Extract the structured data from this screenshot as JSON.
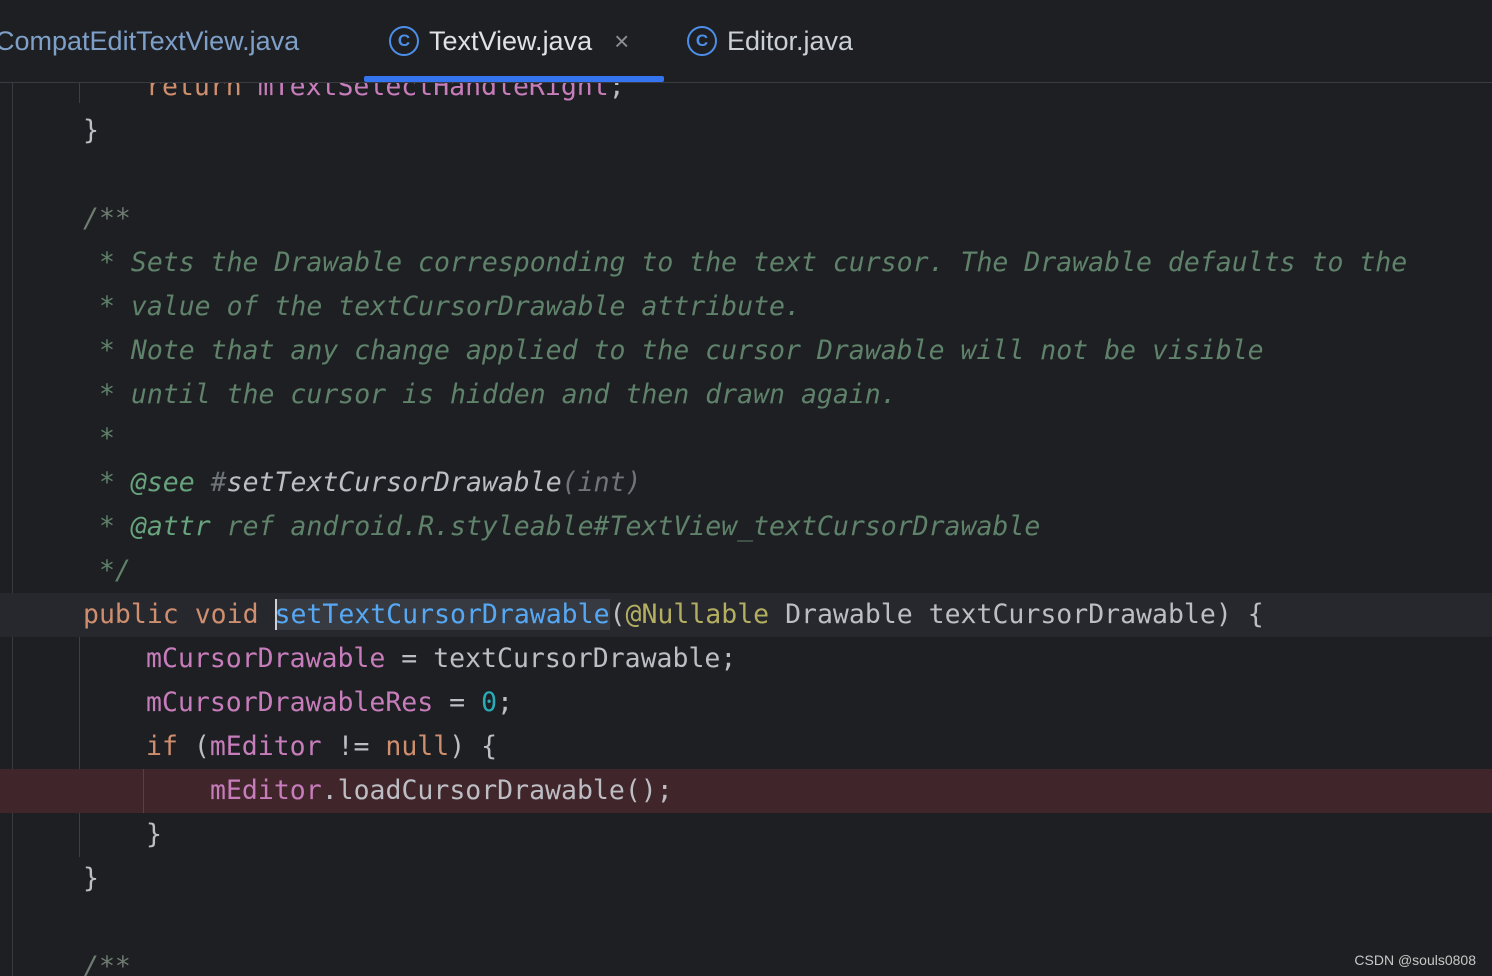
{
  "tabs": [
    {
      "label": "CompatEditTextView.java",
      "icon": "class-icon",
      "active": false
    },
    {
      "label": "TextView.java",
      "icon": "class-icon",
      "active": true,
      "close": "×"
    },
    {
      "label": "Editor.java",
      "icon": "class-icon",
      "active": false
    }
  ],
  "tab_icon_glyph": "C",
  "colors": {
    "background": "#1e1f22",
    "accent": "#3574f0",
    "keyword": "#cf8e6d",
    "field": "#c77dbb",
    "method": "#56a8f5",
    "number": "#2aacb8",
    "annotation": "#b3ae60",
    "doc_comment": "#5f826b",
    "breakpoint_line": "#40252b"
  },
  "code": {
    "l0": {
      "kw": "return",
      "field": "mTextSelectHandleRight",
      "rest": ";"
    },
    "l1": "}",
    "l3": "/**",
    "l4": " * Sets the Drawable corresponding to the text cursor. The Drawable defaults to the",
    "l5": " * value of the textCursorDrawable attribute.",
    "l6": " * Note that any change applied to the cursor Drawable will not be visible",
    "l7": " * until the cursor is hidden and then drawn again.",
    "l8": " *",
    "l9": {
      "star": " * ",
      "tag": "@see",
      "hash": " #",
      "ref": "setTextCursorDrawable",
      "args": "(int)"
    },
    "l10": {
      "star": " * ",
      "tag": "@attr",
      "rest": " ref android.R.styleable#TextView_textCursorDrawable"
    },
    "l11": " */",
    "l12": {
      "kw1": "public",
      "kw2": "void",
      "method": "setTextCursorDrawable",
      "open": "(",
      "ann": "@Nullable",
      "rest": " Drawable textCursorDrawable) {"
    },
    "l13": {
      "field": "mCursorDrawable",
      "rest": " = textCursorDrawable;"
    },
    "l14": {
      "field": "mCursorDrawableRes",
      "op": " = ",
      "num": "0",
      "end": ";"
    },
    "l15": {
      "kw": "if",
      "open": " (",
      "field": "mEditor",
      "op": " != ",
      "kw2": "null",
      "end": ") {"
    },
    "l16": {
      "field": "mEditor",
      "rest": ".loadCursorDrawable();"
    },
    "l17": "}",
    "l18": "}",
    "l20": "/**"
  },
  "watermark": "CSDN @souls0808"
}
